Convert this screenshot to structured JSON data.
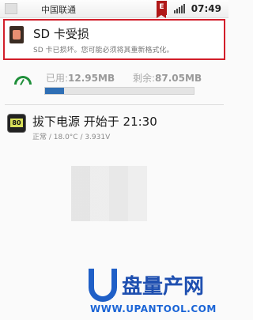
{
  "status_bar": {
    "carrier": "中国联通",
    "notification_badge": "E",
    "time": "07:49"
  },
  "sd_notification": {
    "title": "SD 卡受损",
    "description": "SD 卡已损坏。您可能必须将其重新格式化。"
  },
  "storage": {
    "used_label": "已用:",
    "used_value": "12.95MB",
    "free_label": "剩余:",
    "free_value": "87.05MB",
    "used_fraction": 0.13
  },
  "charging": {
    "title": "拔下电源 开始于 21:30",
    "detail": "正常 / 18.0°C / 3.931V",
    "battery_level_text": "80"
  },
  "watermark": {
    "brand": "盘量产网",
    "url": "WWW.UPANTOOL.COM"
  },
  "colors": {
    "highlight_border": "#d21e2a",
    "progress_fill": "#2f6fb5",
    "watermark_blue": "#1e4fb0"
  }
}
